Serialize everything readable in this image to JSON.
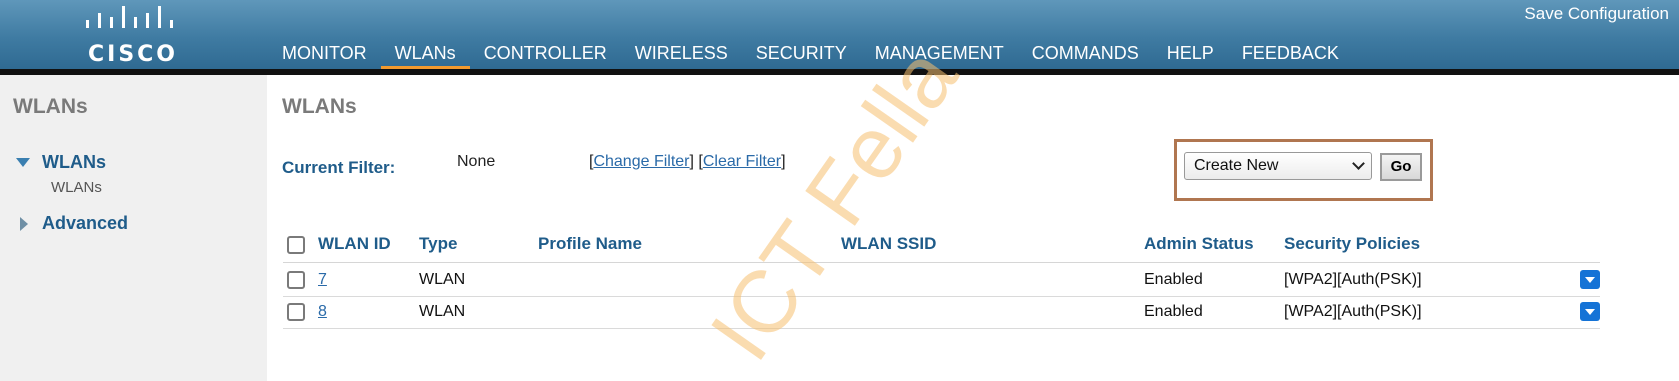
{
  "header": {
    "logo_text": "CISCO",
    "save_configuration": "Save Configuration",
    "nav": [
      {
        "label": "MONITOR",
        "active": false
      },
      {
        "label": "WLANs",
        "active": true
      },
      {
        "label": "CONTROLLER",
        "active": false
      },
      {
        "label": "WIRELESS",
        "active": false
      },
      {
        "label": "SECURITY",
        "active": false
      },
      {
        "label": "MANAGEMENT",
        "active": false
      },
      {
        "label": "COMMANDS",
        "active": false
      },
      {
        "label": "HELP",
        "active": false
      },
      {
        "label": "FEEDBACK",
        "active": false
      }
    ],
    "active_tab_color": "#f29a2e"
  },
  "sidebar": {
    "title": "WLANs",
    "wlans_label": "WLANs",
    "wlans_sub": "WLANs",
    "advanced_label": "Advanced"
  },
  "main": {
    "title": "WLANs",
    "current_filter_label": "Current Filter:",
    "current_filter_value": "None",
    "filter_open": "[",
    "change_filter": "Change Filter",
    "filter_mid": "] [",
    "clear_filter": "Clear Filter",
    "filter_close": "]",
    "create_select_value": "Create New",
    "go_label": "Go"
  },
  "table": {
    "headers": {
      "wlan_id": "WLAN ID",
      "type": "Type",
      "profile_name": "Profile Name",
      "wlan_ssid": "WLAN SSID",
      "admin_status": "Admin Status",
      "security_policies": "Security Policies"
    },
    "rows": [
      {
        "wlan_id": "7",
        "type": "WLAN",
        "profile_name": "",
        "wlan_ssid": "",
        "admin_status": "Enabled",
        "security_policies": "[WPA2][Auth(PSK)]"
      },
      {
        "wlan_id": "8",
        "type": "WLAN",
        "profile_name": "",
        "wlan_ssid": "",
        "admin_status": "Enabled",
        "security_policies": "[WPA2][Auth(PSK)]"
      }
    ]
  },
  "watermark": "ICT Fella"
}
